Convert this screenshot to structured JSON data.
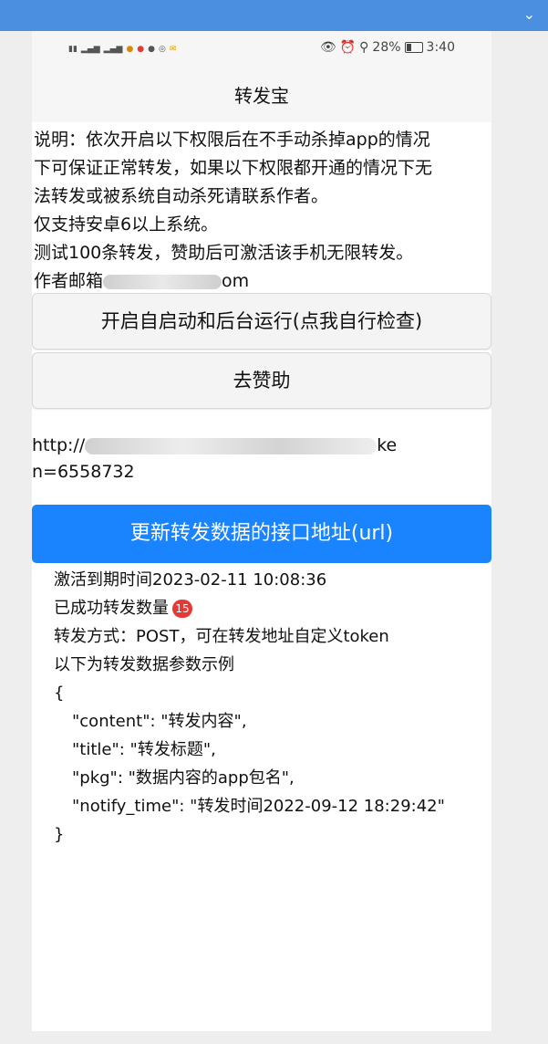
{
  "app": {
    "title": "转发宝"
  },
  "status_bar": {
    "battery": "28%",
    "time": "3:40"
  },
  "description": {
    "line1": "说明：依次开启以下权限后在不手动杀掉app的情况",
    "line2": "下可保证正常转发，如果以下权限都开通的情况下无",
    "line3": "法转发或被系统自动杀死请联系作者。",
    "line4": "仅支持安卓6以上系统。",
    "line5": "测试100条转发，赞助后可激活该手机无限转发。",
    "line6_prefix": "作者邮箱",
    "line6_suffix": "om"
  },
  "buttons": {
    "autostart": "开启自启动和后台运行(点我自行检查)",
    "sponsor": "去赞助",
    "update_url": "更新转发数据的接口地址(url)"
  },
  "url": {
    "prefix": "http://",
    "suffix": "ke",
    "line2": "n=6558732"
  },
  "info": {
    "activation": "激活到期时间2023-02-11 10:08:36",
    "forwarded_label": "已成功转发数量",
    "forwarded_count": "15",
    "method": "转发方式：POST，可在转发地址自定义token",
    "example_label": "以下为转发数据参数示例",
    "brace_open": "{",
    "content": "\"content\": \"转发内容\",",
    "title": "\"title\": \"转发标题\",",
    "pkg": "\"pkg\": \"数据内容的app包名\",",
    "notify_time": "\"notify_time\": \"转发时间2022-09-12 18:29:42\"",
    "brace_close": "}"
  },
  "colors": {
    "accent": "#1a84ff",
    "badge": "#e53935",
    "top_bar": "#4a8fe0"
  }
}
